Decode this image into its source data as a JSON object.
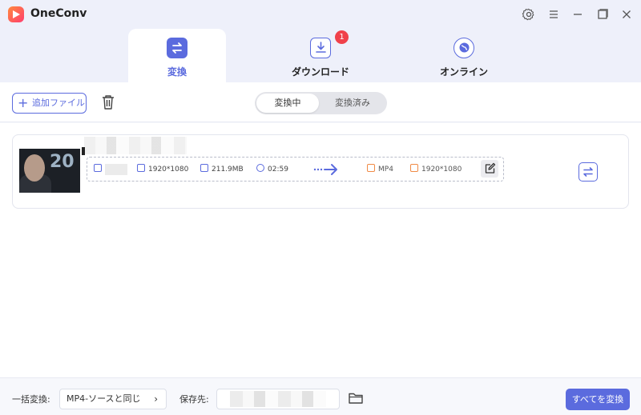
{
  "window": {
    "app_title": "OneConv",
    "controls": [
      "settings-icon",
      "menu-icon",
      "minimize-icon",
      "maximize-icon",
      "close-icon"
    ]
  },
  "tabs": [
    {
      "label": "変換",
      "icon": "convert-arrows-icon",
      "active": true
    },
    {
      "label": "ダウンロード",
      "icon": "download-icon",
      "active": false,
      "badge": "1"
    },
    {
      "label": "オンライン",
      "icon": "globe-icon",
      "active": false
    }
  ],
  "toolbar": {
    "add_file_label": "追加ファイル",
    "converting_label": "変換中",
    "converted_label": "変換済み"
  },
  "file": {
    "thumbnail_text": "20",
    "source": {
      "resolution": "1920*1080",
      "size": "211.9MB",
      "duration": "02:59"
    },
    "output": {
      "format": "MP4",
      "resolution": "1920*1080"
    }
  },
  "bottom": {
    "bulk_label": "一括変換:",
    "bulk_value": "MP4-ソースと同じ",
    "save_label": "保存先:",
    "convert_all_label": "すべてを変換"
  },
  "colors": {
    "accent": "#5b6bde",
    "output_accent": "#f08a45",
    "badge": "#f0414a"
  }
}
